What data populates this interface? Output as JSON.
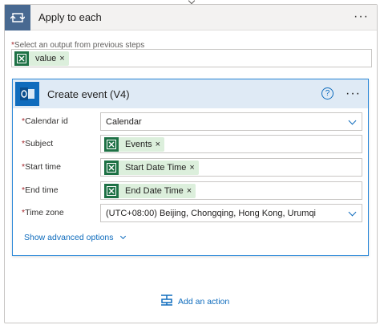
{
  "loop": {
    "title": "Apply to each",
    "more_label": "···",
    "select_required": "*",
    "select_label": "Select an output from previous steps",
    "value_token": "value",
    "token_remove": "×"
  },
  "event": {
    "title": "Create event (V4)",
    "help_label": "?",
    "more_label": "···",
    "rows": [
      {
        "required": "*",
        "label": "Calendar id",
        "value": "Calendar"
      },
      {
        "required": "*",
        "label": "Subject",
        "token": "Events"
      },
      {
        "required": "*",
        "label": "Start time",
        "token": "Start Date Time"
      },
      {
        "required": "*",
        "label": "End time",
        "token": "End Date Time"
      },
      {
        "required": "*",
        "label": "Time zone",
        "value": "(UTC+08:00) Beijing, Chongqing, Hong Kong, Urumqi"
      }
    ],
    "token_remove": "×",
    "advanced_label": "Show advanced options"
  },
  "footer": {
    "add_action_label": "Add an action"
  },
  "colors": {
    "loop_icon_bg": "#486991",
    "event_border": "#2b88d8",
    "outlook_blue": "#0f6cbd",
    "excel_green": "#1e7145",
    "token_bg": "#dcefdc"
  }
}
